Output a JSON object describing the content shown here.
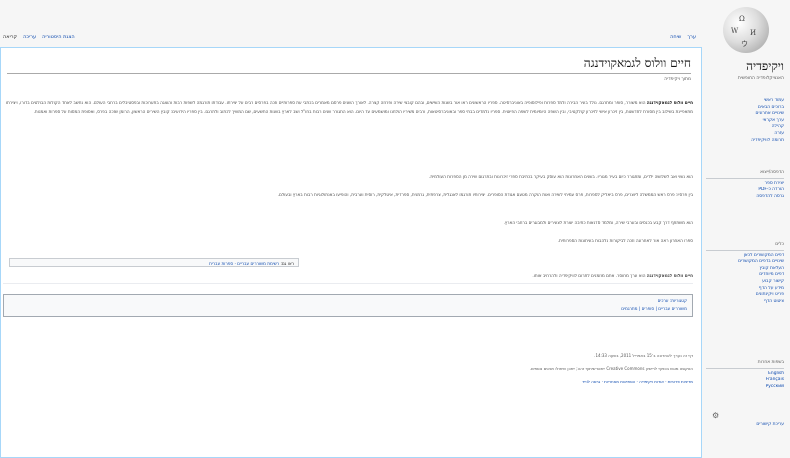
{
  "tabs_left": [
    "קריאה",
    "עריכה",
    "הצגת היסטוריה"
  ],
  "tabs_right": [
    "ערך",
    "שיחה"
  ],
  "article": {
    "title": "חיים וולוס לגמאקוידנגה",
    "from": "מתוך ויקיפדיה",
    "paragraphs": [
      {
        "lead": "חיים וולוס לגמאקוידנגה",
        "text": " הוא משורר, סופר ומתרגם. נולד בעיר הבירה ולמד ספרות ופילוסופיה באוניברסיטה. ספריו הראשונים ראו אור בשנות השישים, ובהם קובצי שירה ופרוזה קצרה. לאורך השנים פרסם מאמרים בכתבי עת ספרותיים וזכה בפרסים רבים על יצירתו. עבודתו תורגמה לשפות רבות והוצגה בתערוכות ובפסטיבלים ברחבי העולם. הוא נחשב לאחד הקולות הבולטים בדורו, ויצירתו מתאפיינת בשילוב בין מסורת לחדשנות, בין זיכרון אישי לזיכרון קולקטיבי, ובין השפה היומיומית לשפה הפיוטית. ספריו נלמדים בבתי ספר ובאוניברסיטאות, ורבים משיריו הולחנו ומושמעים עד היום. הוא התגורר שנים רבות בחו\"ל ושב לארץ בשנות התשעים, שם המשיך לכתוב ולתרגם. בין ספריו הידועים: קובץ השירים הראשון, הרומן שזכה בפרס, ואסופת המסות על ספרות ואמנות."
      },
      {
        "lead": "",
        "text": "הוא נשוי ואב לשלושה ילדים, ומתגורר כיום בעיר מגוריו. בשנים האחרונות הוא עוסק בעיקר בכתיבת ספרי זיכרונות ובתרגום שירה מן הספרות העולמית."
      },
      {
        "lead": "",
        "text": "בין פרסיו: פרס ראש הממשלה ליוצרים, פרס ביאליק לספרות, פרס עמיחי לשירה ואות הוקרה מטעם אגודת הסופרים. יצירותיו תורגמו לאנגלית, צרפתית, גרמנית, ספרדית, איטלקית, רוסית וערבית, והופיעו באנתולוגיות רבות בארץ ובעולם."
      },
      {
        "lead": "",
        "text": "הוא משתתף דרך קבע בכנסים ובערבי שירה, ומלמד סדנאות כתיבה יוצרת לצעירים ולמבוגרים ברחבי הארץ."
      },
      {
        "lead": "",
        "text": "ספרו האחרון ראה אור לאחרונה וזכה לביקורות נלהבות בעיתונות הספרותית."
      }
    ],
    "see_also_label": "ראו גם:",
    "see_also_links": "רשימת משוררים עבריים · ספרות עברית",
    "note_lead": "חיים וולוס לגמאקוידנגה",
    "note_text": "הוא ערך מחוסר. אתם מוזמנים לתרום לוויקיפדיה ולהרחיב אותו.",
    "categories_label": "קטגוריות: ערכים",
    "categories_links": "משוררים עבריים | סופרים | מתרגמים",
    "footer_lines": [
      "דף זה נערך לאחרונה ב־15 באפריל 2011, בשעה 14:33.",
      "הטקסט מוגש בכפוף לרישיון Creative Commons ייחוס-שיתוף זהה; ייתכן שיחולו תנאים נוספים.",
      "מדיניות פרטיות · אודות ויקיפדיה · הסתייגות מאחריות · גרסה לנייד"
    ]
  },
  "sidebar": {
    "wordmark": "ויקיפדיה",
    "tagline": "האנציקלופדיה החופשית",
    "groups": [
      {
        "header": "",
        "items": [
          "עמוד ראשי",
          "ברוכים הבאים",
          "שינויים אחרונים",
          "ערך אקראי",
          "קהילה",
          "עזרה",
          "תרומה לוויקיפדיה"
        ]
      },
      {
        "header": "הדפסה/ייצוא",
        "items": [
          "יצירת ספר",
          "הורדה כ-PDF",
          "גרסה להדפסה"
        ]
      },
      {
        "header": "כלים",
        "items": [
          "דפים המקושרים לכאן",
          "שינויים בדפים המקושרים",
          "העלאת קובץ",
          "דפים מיוחדים",
          "קישור קבוע",
          "מידע על הדף",
          "פריט ויקינתונים",
          "ציטוט הדף"
        ]
      },
      {
        "header": "בשפות אחרות",
        "items": [
          "English",
          "Français",
          "Русский"
        ]
      }
    ],
    "edit_links": "עריכת קישורים"
  }
}
